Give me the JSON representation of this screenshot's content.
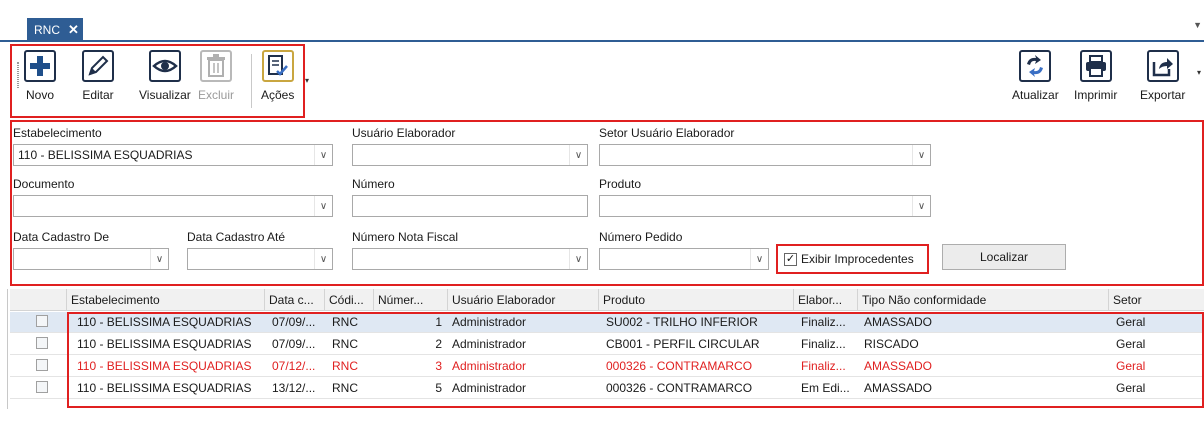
{
  "tab": {
    "label": "RNC",
    "close": "✕"
  },
  "toolbar": {
    "novo": "Novo",
    "editar": "Editar",
    "visualizar": "Visualizar",
    "excluir": "Excluir",
    "acoes": "Ações",
    "atualizar": "Atualizar",
    "imprimir": "Imprimir",
    "exportar": "Exportar"
  },
  "filters": {
    "estabelecimento_label": "Estabelecimento",
    "estabelecimento_value": "110 - BELISSIMA ESQUADRIAS",
    "usuario_label": "Usuário Elaborador",
    "setor_label": "Setor Usuário Elaborador",
    "documento_label": "Documento",
    "numero_label": "Número",
    "produto_label": "Produto",
    "data_de_label": "Data Cadastro De",
    "data_ate_label": "Data Cadastro Até",
    "nota_label": "Número Nota Fiscal",
    "pedido_label": "Número Pedido",
    "improcedentes_label": "Exibir Improcedentes",
    "improcedentes_checked": true,
    "localizar": "Localizar"
  },
  "grid": {
    "headers": [
      "Estabelecimento",
      "Data c...",
      "Códi...",
      "Númer...",
      "Usuário Elaborador",
      "Produto",
      "Elabor...",
      "Tipo Não conformidade",
      "Setor"
    ],
    "rows": [
      {
        "estab": "110 - BELISSIMA ESQUADRIAS",
        "data": "07/09/...",
        "codigo": "RNC",
        "numero": "1",
        "usuario": "Administrador",
        "produto": "SU002 - TRILHO INFERIOR",
        "elab": "Finaliz...",
        "tipo": "AMASSADO",
        "setor": "Geral"
      },
      {
        "estab": "110 - BELISSIMA ESQUADRIAS",
        "data": "07/09/...",
        "codigo": "RNC",
        "numero": "2",
        "usuario": "Administrador",
        "produto": "CB001 - PERFIL CIRCULAR",
        "elab": "Finaliz...",
        "tipo": "RISCADO",
        "setor": "Geral"
      },
      {
        "estab": "110 - BELISSIMA ESQUADRIAS",
        "data": "07/12/...",
        "codigo": "RNC",
        "numero": "3",
        "usuario": "Administrador",
        "produto": "000326 - CONTRAMARCO",
        "elab": "Finaliz...",
        "tipo": "AMASSADO",
        "setor": "Geral"
      },
      {
        "estab": "110 - BELISSIMA ESQUADRIAS",
        "data": "13/12/...",
        "codigo": "RNC",
        "numero": "5",
        "usuario": "Administrador",
        "produto": "000326 - CONTRAMARCO",
        "elab": "Em Edi...",
        "tipo": "AMASSADO",
        "setor": "Geral"
      }
    ]
  },
  "colors": {
    "accent": "#2f5d94",
    "highlight": "#e02020",
    "selected_row": "#dfe8f3"
  },
  "icons": [
    "plus-icon",
    "pencil-icon",
    "eye-icon",
    "trash-icon",
    "checklist-icon",
    "refresh-icon",
    "printer-icon",
    "export-icon"
  ]
}
